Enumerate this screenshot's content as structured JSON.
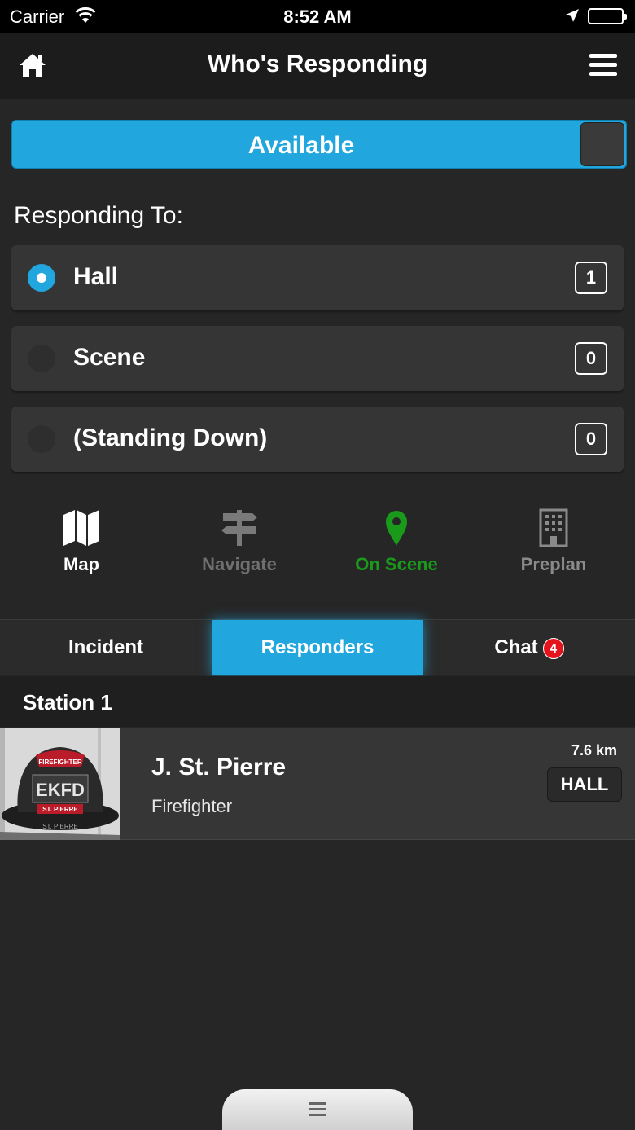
{
  "status_bar": {
    "carrier": "Carrier",
    "time": "8:52 AM"
  },
  "nav": {
    "title": "Who's Responding"
  },
  "availability": {
    "label": "Available",
    "accent": "#21a6dd"
  },
  "responding": {
    "label": "Responding To:",
    "options": [
      {
        "label": "Hall",
        "count": "1",
        "selected": true
      },
      {
        "label": "Scene",
        "count": "0",
        "selected": false
      },
      {
        "label": "(Standing Down)",
        "count": "0",
        "selected": false
      }
    ]
  },
  "actions": [
    {
      "label": "Map",
      "icon": "map-icon",
      "color": "#ffffff"
    },
    {
      "label": "Navigate",
      "icon": "signpost-icon",
      "color": "#6f6f6f"
    },
    {
      "label": "On Scene",
      "icon": "map-pin-icon",
      "color": "#1a9a1a"
    },
    {
      "label": "Preplan",
      "icon": "building-icon",
      "color": "#8a8a8a"
    }
  ],
  "tabs": [
    {
      "label": "Incident",
      "active": false
    },
    {
      "label": "Responders",
      "active": true
    },
    {
      "label": "Chat",
      "active": false,
      "badge": "4"
    }
  ],
  "group": {
    "title": "Station 1",
    "responders": [
      {
        "name": "J. St. Pierre",
        "role": "Firefighter",
        "distance": "7.6 km",
        "status": "HALL",
        "helmet_text": [
          "FIREFIGHTER",
          "EKFD",
          "ST. PIERRE",
          "ST. PIERRE"
        ]
      }
    ]
  }
}
